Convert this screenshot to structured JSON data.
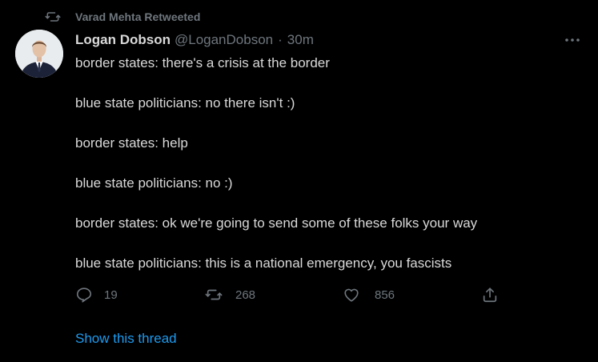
{
  "retweet_banner": {
    "text": "Varad Mehta Retweeted",
    "icon": "retweet-icon"
  },
  "author": {
    "name": "Logan Dobson",
    "handle": "@LoganDobson",
    "separator": "·",
    "time": "30m"
  },
  "more_icon": "more-dots-icon",
  "body": [
    "border states: there's a crisis at the border",
    "blue state politicians: no there isn't :)",
    "border states: help",
    "blue state politicians: no :)",
    "border states: ok we're going to send some of these folks your way",
    "blue state politicians: this is a national emergency, you fascists"
  ],
  "actions": {
    "reply": {
      "icon": "reply-icon",
      "count": "19"
    },
    "retweet": {
      "icon": "retweet-icon",
      "count": "268"
    },
    "like": {
      "icon": "heart-icon",
      "count": "856"
    },
    "share": {
      "icon": "share-icon"
    }
  },
  "show_thread": "Show this thread",
  "colors": {
    "background": "#000000",
    "text": "#d9d9d9",
    "muted": "#6e767d",
    "link": "#1d9bf0"
  }
}
